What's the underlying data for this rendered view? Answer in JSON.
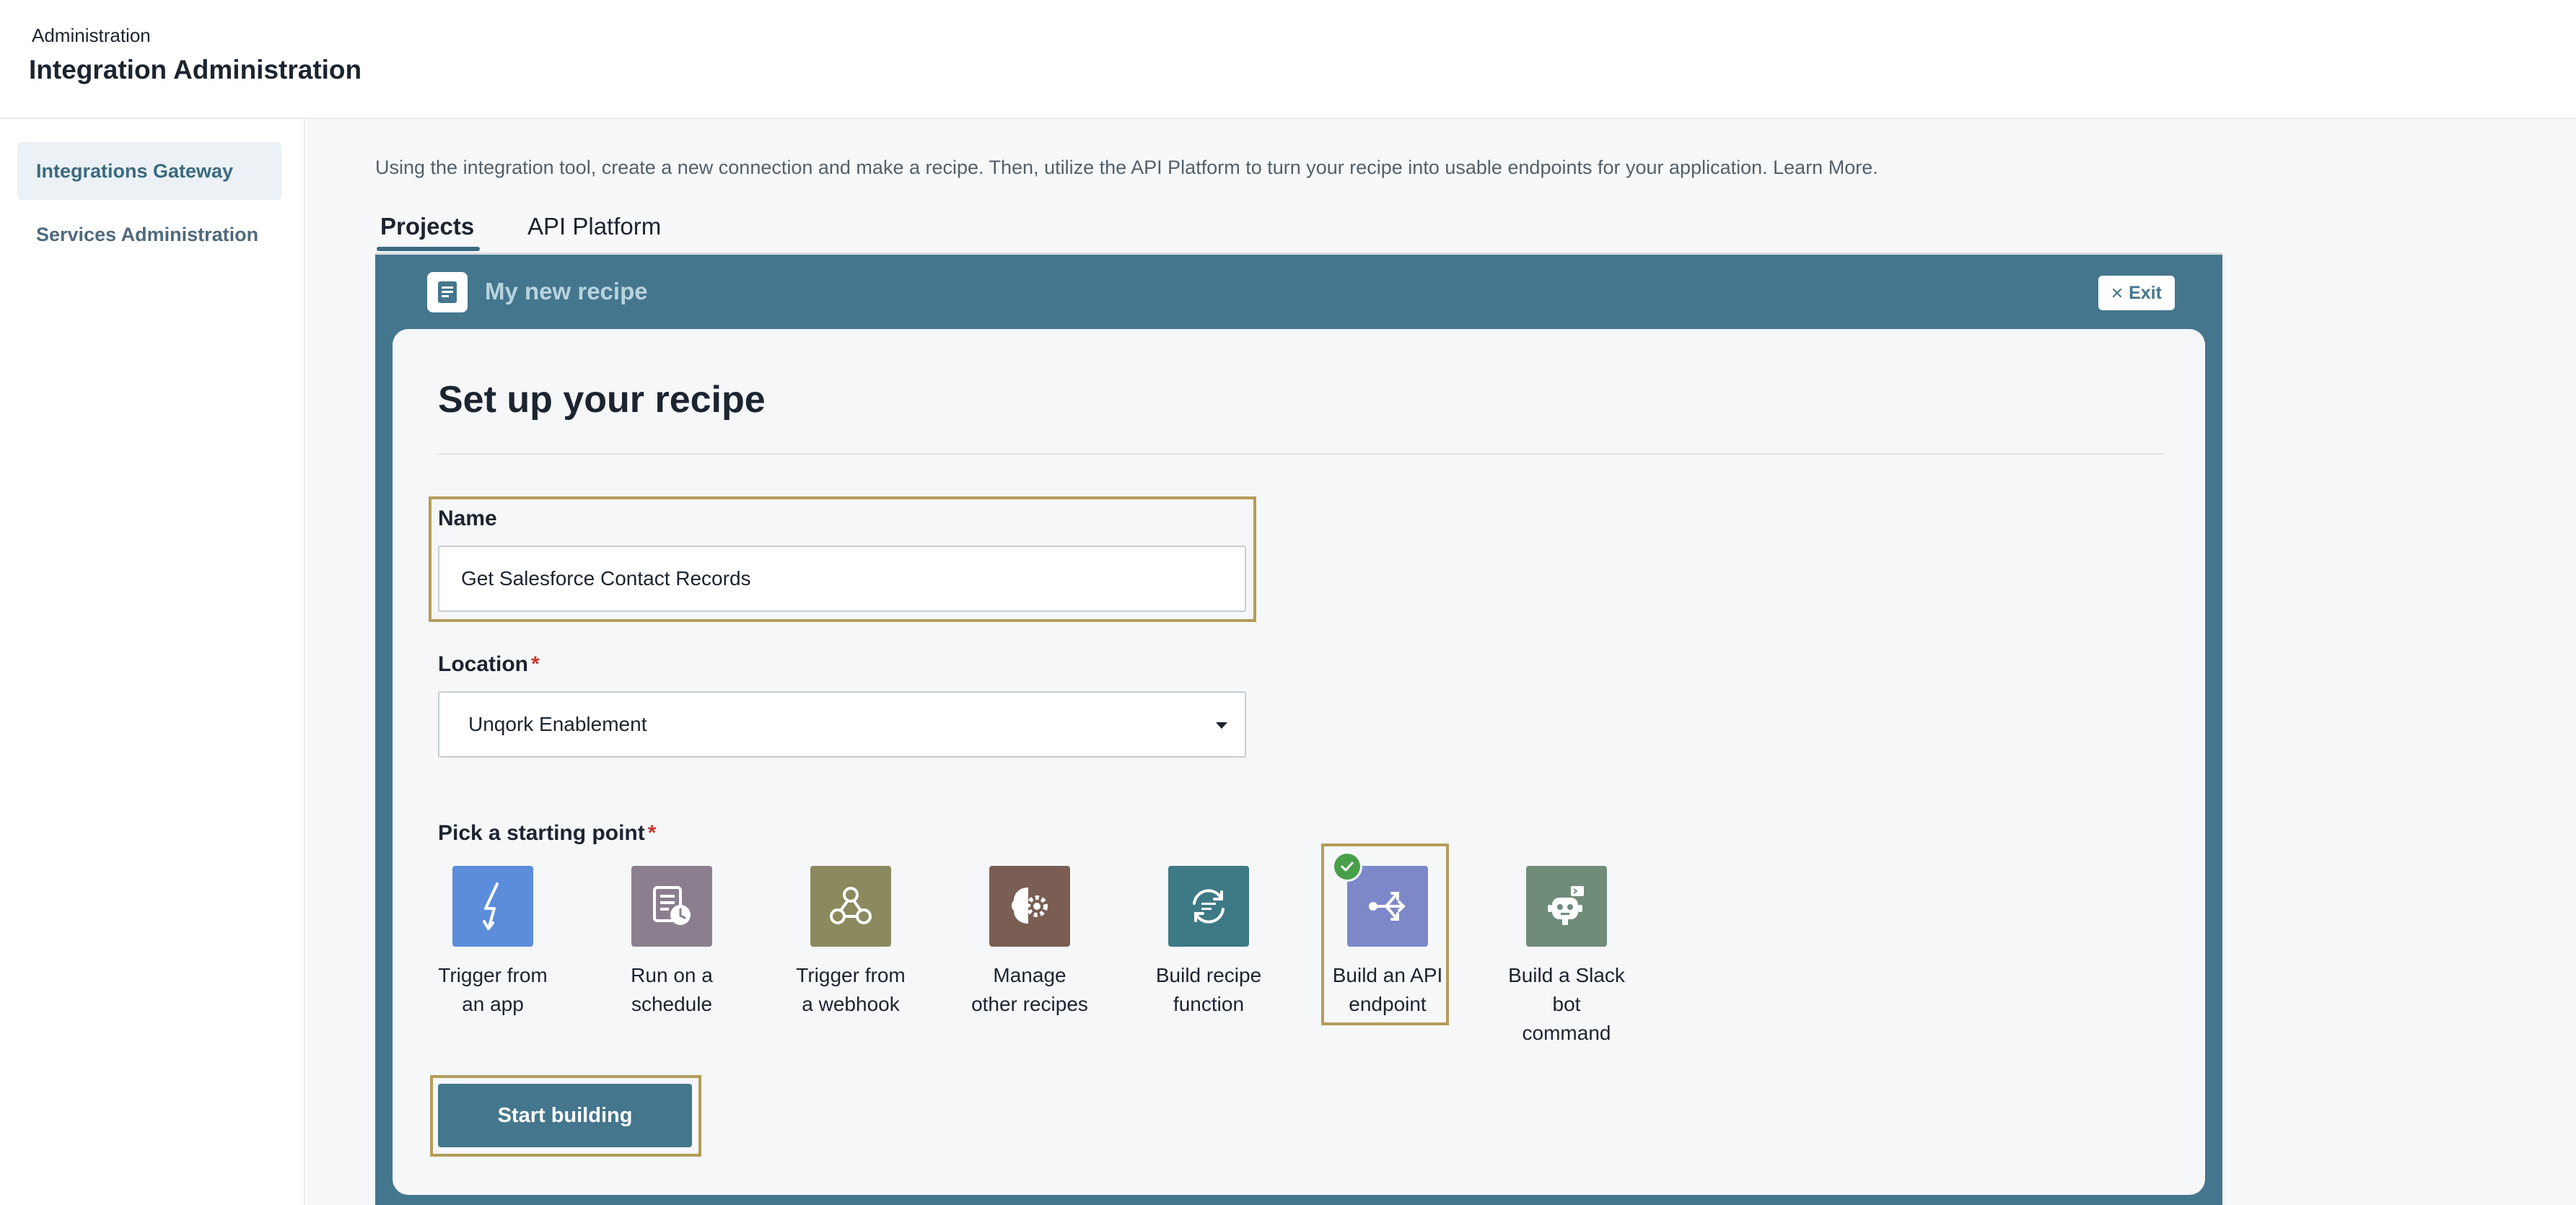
{
  "header": {
    "breadcrumb": "Administration",
    "title": "Integration Administration"
  },
  "sidebar": {
    "items": [
      {
        "label": "Integrations Gateway",
        "active": true
      },
      {
        "label": "Services Administration",
        "active": false
      }
    ]
  },
  "main": {
    "intro": "Using the integration tool, create a new connection and make a recipe. Then, utilize the API Platform to turn your recipe into usable endpoints for your application. ",
    "learn_more": "Learn More.",
    "tabs": [
      {
        "label": "Projects",
        "active": true
      },
      {
        "label": "API Platform",
        "active": false
      }
    ]
  },
  "panel": {
    "title": "My new recipe",
    "exit_label": "Exit"
  },
  "form": {
    "heading": "Set up your recipe",
    "name_label": "Name",
    "name_value": "Get Salesforce Contact Records",
    "location_label": "Location",
    "location_required": "*",
    "location_value": "Unqork Enablement",
    "pick_label": "Pick a starting point",
    "pick_required": "*",
    "starting_points": [
      {
        "line1": "Trigger from",
        "line2": "an app",
        "line3": "",
        "icon": "lightning-icon"
      },
      {
        "line1": "Run on a",
        "line2": "schedule",
        "line3": "",
        "icon": "schedule-icon"
      },
      {
        "line1": "Trigger from",
        "line2": "a webhook",
        "line3": "",
        "icon": "webhook-icon"
      },
      {
        "line1": "Manage",
        "line2": "other recipes",
        "line3": "",
        "icon": "brain-gear-icon"
      },
      {
        "line1": "Build recipe",
        "line2": "function",
        "line3": "",
        "icon": "function-cycle-icon"
      },
      {
        "line1": "Build an API",
        "line2": "endpoint",
        "line3": "",
        "icon": "api-endpoint-icon",
        "selected": true
      },
      {
        "line1": "Build a Slack",
        "line2": "bot",
        "line3": "command",
        "icon": "slack-bot-icon"
      }
    ],
    "start_label": "Start building"
  },
  "colors": {
    "panel": "#44768d",
    "highlight": "#b49c5a",
    "check": "#49a04a"
  }
}
